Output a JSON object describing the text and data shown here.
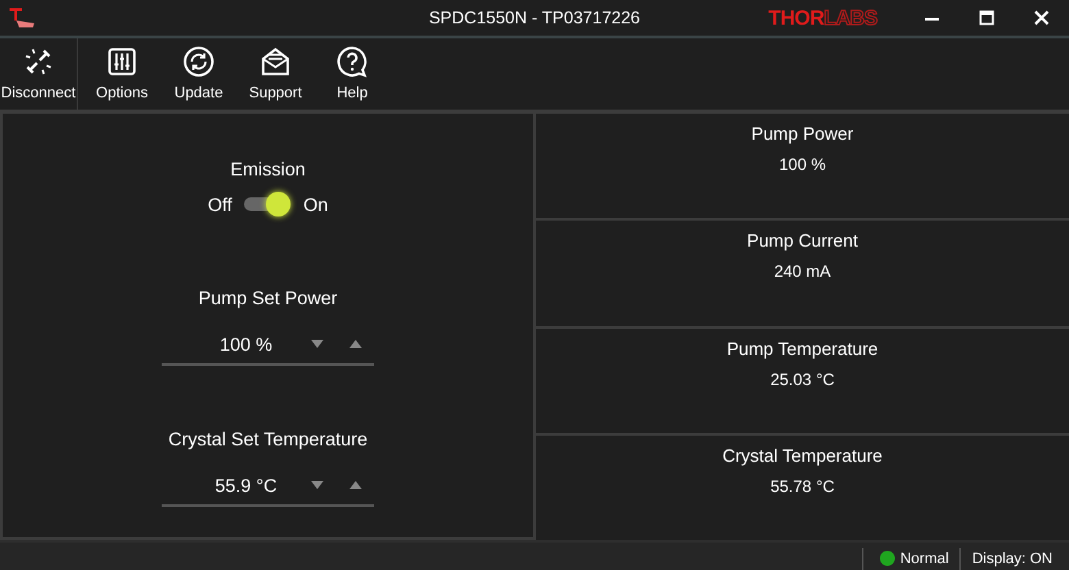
{
  "window": {
    "title": "SPDC1550N - TP03717226",
    "brand_strong": "THOR",
    "brand_light": "LABS"
  },
  "toolbar": [
    {
      "kind": "disconnect",
      "label": "Disconnect"
    },
    {
      "kind": "options",
      "label": "Options"
    },
    {
      "kind": "update",
      "label": "Update"
    },
    {
      "kind": "support",
      "label": "Support"
    },
    {
      "kind": "help",
      "label": "Help"
    }
  ],
  "emission": {
    "label": "Emission",
    "off_label": "Off",
    "on_label": "On",
    "on": true
  },
  "setpoints": [
    {
      "label": "Pump Set Power",
      "value": "100 %"
    },
    {
      "label": "Crystal Set Temperature",
      "value": "55.9 °C"
    }
  ],
  "readouts": [
    {
      "label": "Pump Power",
      "value": "100 %"
    },
    {
      "label": "Pump Current",
      "value": "240 mA"
    },
    {
      "label": "Pump Temperature",
      "value": "25.03 °C"
    },
    {
      "label": "Crystal Temperature",
      "value": "55.78 °C"
    }
  ],
  "status_bar": {
    "state": "Normal",
    "display": "Display: ON"
  }
}
